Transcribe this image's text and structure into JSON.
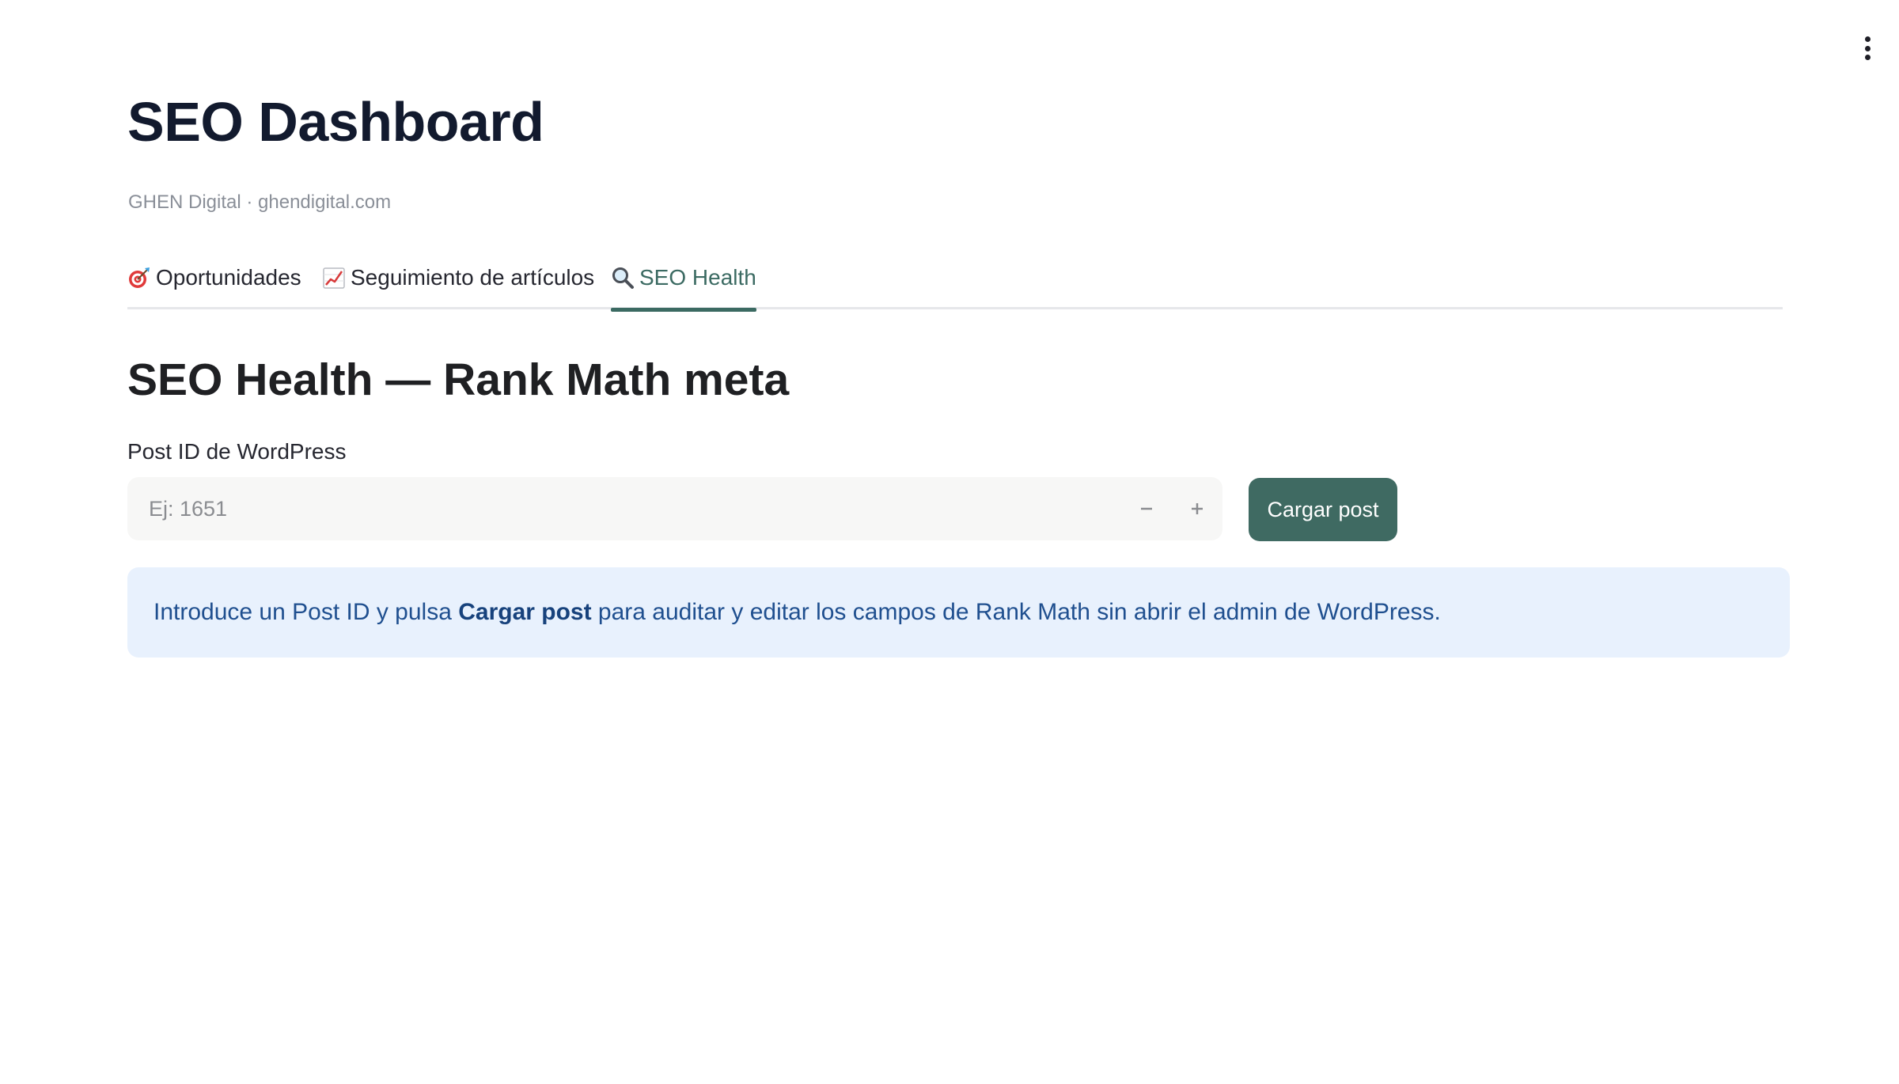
{
  "header": {
    "title": "SEO Dashboard",
    "subtitle": "GHEN Digital · ghendigital.com"
  },
  "tabs": [
    {
      "icon": "target-icon",
      "label": "Oportunidades",
      "active": false
    },
    {
      "icon": "chart-increasing-icon",
      "label": "Seguimiento de artículos",
      "active": false
    },
    {
      "icon": "magnifier-icon",
      "label": "SEO Health",
      "active": true
    }
  ],
  "main": {
    "section_title": "SEO Health — Rank Math meta",
    "post_id_field": {
      "label": "Post ID de WordPress",
      "value": "",
      "placeholder": "Ej: 1651"
    },
    "load_button_label": "Cargar post",
    "info": {
      "prefix": "Introduce un Post ID y pulsa ",
      "bold": "Cargar post",
      "suffix": " para auditar y editar los campos de Rank Math sin abrir el admin de WordPress."
    }
  },
  "colors": {
    "accent": "#3f6a62",
    "info_background": "#e8f1fd",
    "info_text": "#1f4f8f"
  }
}
